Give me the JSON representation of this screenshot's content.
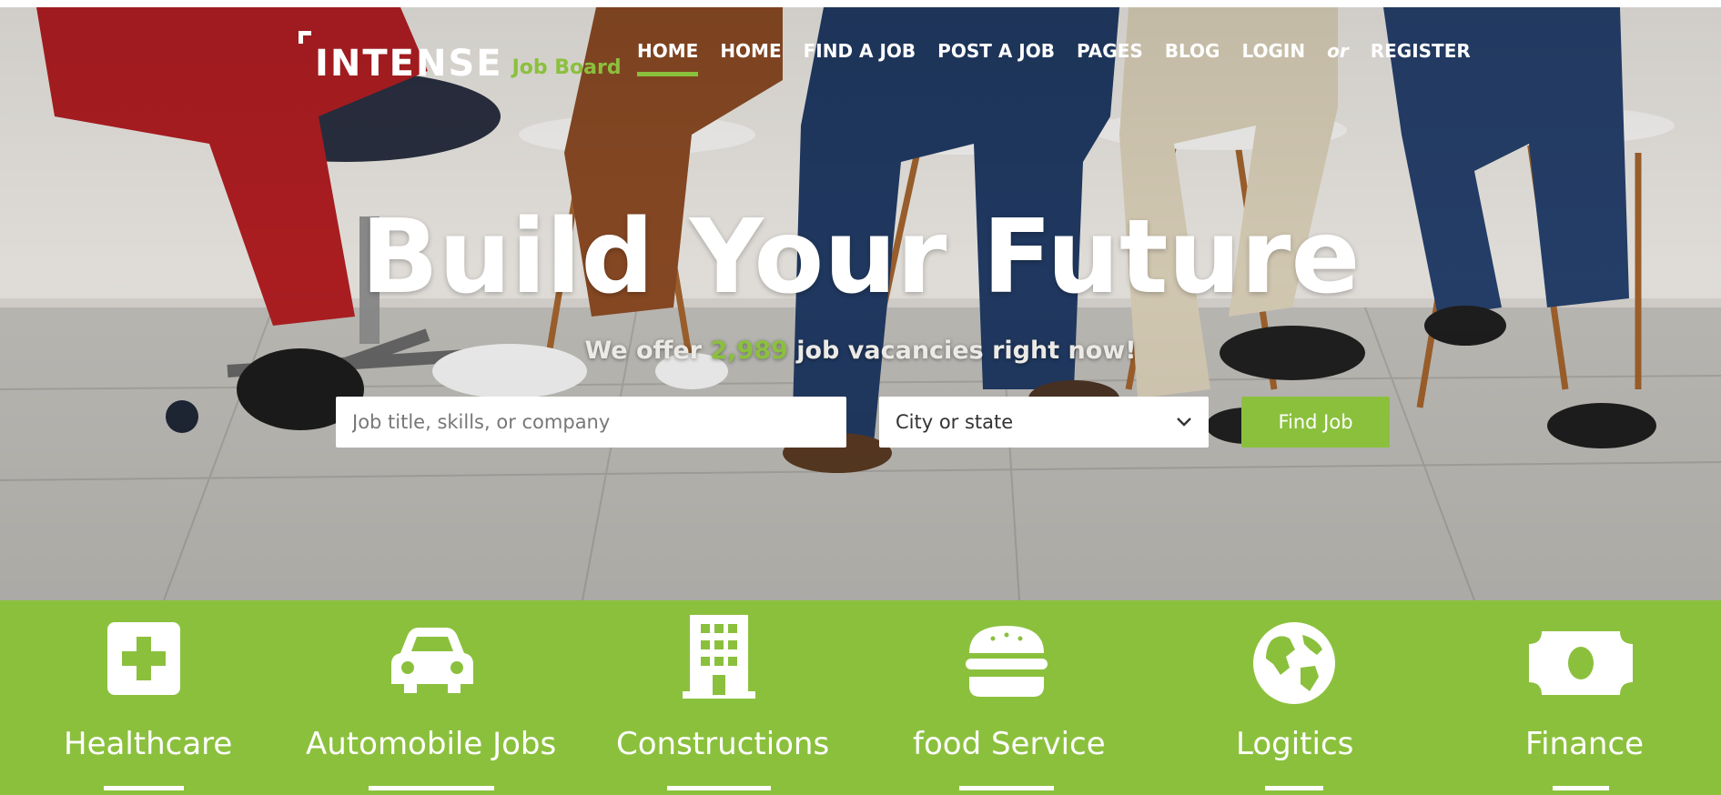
{
  "brand": {
    "name": "INTENSE",
    "tagline": "Job Board",
    "accent": "#8bc03d"
  },
  "nav": {
    "items": [
      {
        "label": "HOME",
        "active": true
      },
      {
        "label": "HOME",
        "active": false
      },
      {
        "label": "FIND A JOB",
        "active": false
      },
      {
        "label": "POST A JOB",
        "active": false
      },
      {
        "label": "PAGES",
        "active": false
      },
      {
        "label": "BLOG",
        "active": false
      },
      {
        "label": "LOGIN",
        "active": false
      }
    ],
    "separator": "or",
    "register": "REGISTER"
  },
  "hero": {
    "title": "Build Your Future",
    "subtitle_before": "We offer",
    "job_count": "2,989",
    "subtitle_after": "job vacancies right now!"
  },
  "search": {
    "keyword_placeholder": "Job title, skills, or company",
    "location_value": "City or state",
    "submit_label": "Find Job"
  },
  "categories": [
    {
      "label": "Healthcare",
      "icon": "medical-cross-icon"
    },
    {
      "label": "Automobile Jobs",
      "icon": "car-icon"
    },
    {
      "label": "Constructions",
      "icon": "building-icon"
    },
    {
      "label": "food Service",
      "icon": "burger-icon"
    },
    {
      "label": "Logitics",
      "icon": "globe-icon"
    },
    {
      "label": "Finance",
      "icon": "money-icon"
    }
  ]
}
